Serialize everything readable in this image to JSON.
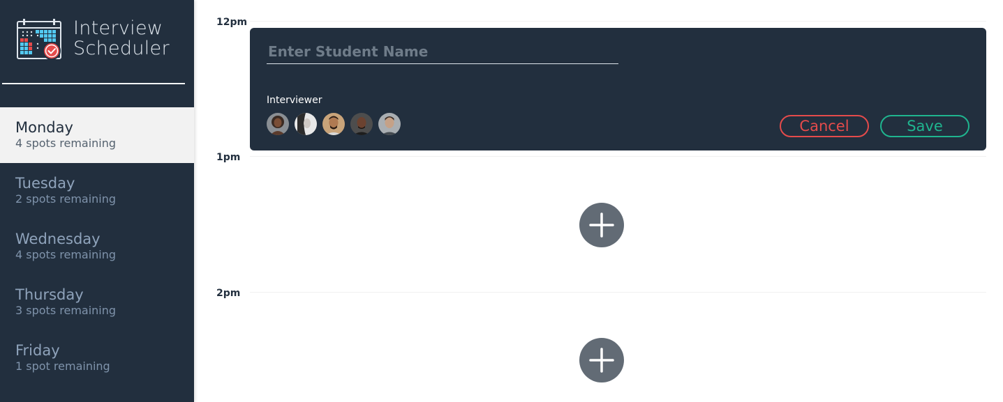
{
  "app": {
    "title_line1": "Interview",
    "title_line2": "Scheduler"
  },
  "sidebar": {
    "days": [
      {
        "name": "Monday",
        "spots": "4 spots remaining",
        "selected": true
      },
      {
        "name": "Tuesday",
        "spots": "2 spots remaining",
        "selected": false
      },
      {
        "name": "Wednesday",
        "spots": "4 spots remaining",
        "selected": false
      },
      {
        "name": "Thursday",
        "spots": "3 spots remaining",
        "selected": false
      },
      {
        "name": "Friday",
        "spots": "1 spot remaining",
        "selected": false
      }
    ]
  },
  "schedule": {
    "times": [
      "12pm",
      "1pm",
      "2pm"
    ],
    "form": {
      "student_placeholder": "Enter Student Name",
      "student_value": "",
      "interviewer_label": "Interviewer",
      "interviewers": [
        "interviewer-avatar",
        "interviewer-avatar",
        "interviewer-avatar",
        "interviewer-avatar",
        "interviewer-avatar"
      ],
      "cancel_label": "Cancel",
      "save_label": "Save"
    },
    "add_icon": "plus-icon"
  },
  "colors": {
    "sidebar_bg": "#222f3e",
    "selected_bg": "#f2f2f2",
    "danger": "#e54b4b",
    "success": "#1fb58f",
    "add_button": "#626b75"
  }
}
